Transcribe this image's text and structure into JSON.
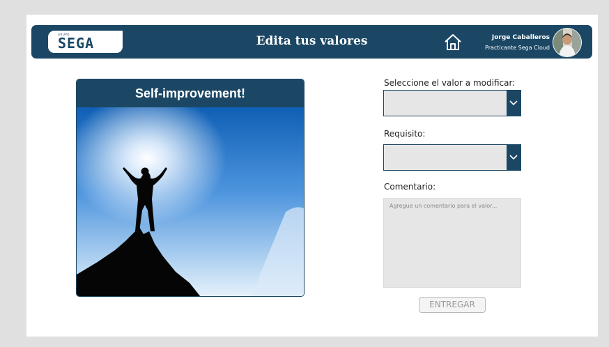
{
  "header": {
    "logo_small": "GRUPO",
    "logo_mark": "SEGA",
    "title": "Edita tus valores",
    "home_icon": "home-icon",
    "user": {
      "name": "Jorge Caballeros",
      "role": "Practicante Sega Cloud"
    }
  },
  "card": {
    "title": "Self-improvement!"
  },
  "form": {
    "value_label": "Seleccione el valor a modificar:",
    "value_selected": "",
    "requirement_label": "Requisito:",
    "requirement_selected": "",
    "comment_label": "Comentario:",
    "comment_placeholder": "Agregue un comentario para el valor...",
    "comment_value": "",
    "submit_label": "ENTREGAR",
    "dropdown_icon": "chevron-down-icon"
  },
  "colors": {
    "brand": "#1b4765",
    "canvas": "#ffffff",
    "backdrop": "#e0e0e0",
    "field": "#e6e6e6"
  }
}
